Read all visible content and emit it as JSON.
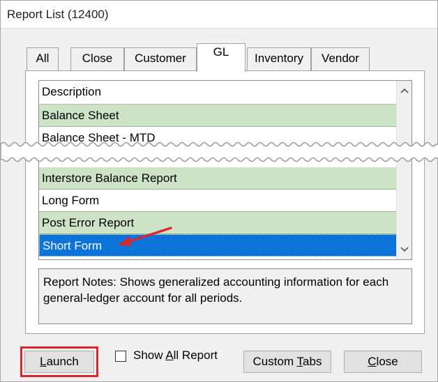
{
  "window": {
    "title": "Report List (12400)"
  },
  "tabs": [
    {
      "label": "All"
    },
    {
      "label": "Close"
    },
    {
      "label": "Customer"
    },
    {
      "label": "GL"
    },
    {
      "label": "Inventory"
    },
    {
      "label": "Vendor"
    }
  ],
  "active_tab": "GL",
  "report_list": {
    "column_header": "Description",
    "rows": [
      {
        "label": "Balance Sheet",
        "style": "green"
      },
      {
        "label": "Balance Sheet - MTD",
        "style": "white"
      },
      {
        "label": "Interstore Balance Report",
        "style": "green"
      },
      {
        "label": "Long Form",
        "style": "white"
      },
      {
        "label": "Post Error Report",
        "style": "green"
      },
      {
        "label": "Short Form",
        "style": "selected"
      }
    ]
  },
  "notes": {
    "text": "Report Notes:  Shows generalized accounting information for each general-ledger account for all periods."
  },
  "buttons": {
    "launch": {
      "prefix": "",
      "mnemonic": "L",
      "rest": "aunch"
    },
    "show_all": {
      "prefix": "Show ",
      "mnemonic": "A",
      "rest": "ll Report"
    },
    "custom_tabs": {
      "prefix": "Custom ",
      "mnemonic": "T",
      "rest": "abs"
    },
    "close": {
      "prefix": "",
      "mnemonic": "C",
      "rest": "lose"
    }
  },
  "colors": {
    "row_green": "#cce3c5",
    "selected": "#0a74d9",
    "highlight": "#d9262f"
  },
  "icons": {
    "scroll_up": "chevron-up-icon",
    "scroll_down": "chevron-down-icon",
    "annotation": "red-arrow-icon"
  }
}
